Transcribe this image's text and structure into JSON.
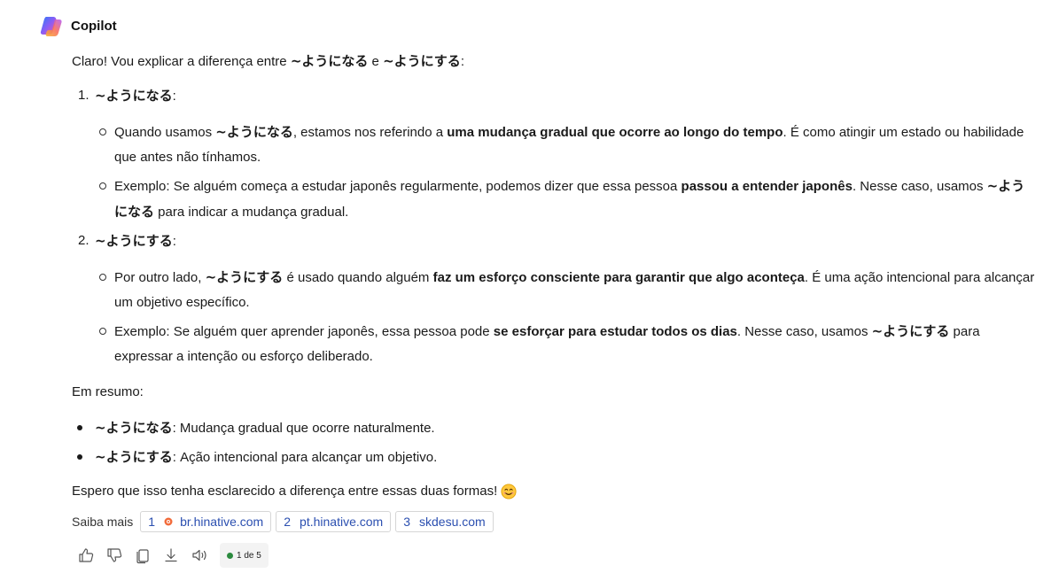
{
  "header": {
    "assistant_name": "Copilot"
  },
  "message": {
    "intro": {
      "prefix": "Claro! Vou explicar a diferença entre ",
      "term1": "~ようになる",
      "mid": " e ",
      "term2": "~ようにする",
      "suffix": ":"
    },
    "items": [
      {
        "number": "1.",
        "term": "~ようになる",
        "colon": ":",
        "points": [
          {
            "a": "Quando usamos ",
            "b": "~ようになる",
            "c": ", estamos nos referindo a ",
            "d": "uma mudança gradual que ocorre ao longo do tempo",
            "e": ". É como atingir um estado ou habilidade que antes não tínhamos."
          },
          {
            "a": "Exemplo: Se alguém começa a estudar japonês regularmente, podemos dizer que essa pessoa ",
            "b": "passou a entender japonês",
            "c": ". Nesse caso, usamos ",
            "d": "~ようになる",
            "e": " para indicar a mudança gradual."
          }
        ]
      },
      {
        "number": "2.",
        "term": "~ようにする",
        "colon": ":",
        "points": [
          {
            "a": "Por outro lado, ",
            "b": "~ようにする",
            "c": " é usado quando alguém ",
            "d": "faz um esforço consciente para garantir que algo aconteça",
            "e": ". É uma ação intencional para alcançar um objetivo específico."
          },
          {
            "a": "Exemplo: Se alguém quer aprender japonês, essa pessoa pode ",
            "b": "se esforçar para estudar todos os dias",
            "c": ". Nesse caso, usamos ",
            "d": "~ようにする",
            "e": " para expressar a intenção ou esforço deliberado."
          }
        ]
      }
    ],
    "summary_title": "Em resumo:",
    "summary": [
      {
        "term": "~ようになる",
        "text": ": Mudança gradual que ocorre naturalmente."
      },
      {
        "term": "~ようにする",
        "text": ": Ação intencional para alcançar um objetivo."
      }
    ],
    "closing": "Espero que isso tenha esclarecido a diferença entre essas duas formas!"
  },
  "sources": {
    "label": "Saiba mais",
    "items": [
      {
        "num": "1",
        "domain": "br.hinative.com",
        "has_favicon": true
      },
      {
        "num": "2",
        "domain": "pt.hinative.com",
        "has_favicon": false
      },
      {
        "num": "3",
        "domain": "skdesu.com",
        "has_favicon": false
      }
    ]
  },
  "actions": {
    "icons": [
      "thumbs-up-icon",
      "thumbs-down-icon",
      "copy-icon",
      "download-icon",
      "read-aloud-icon"
    ],
    "counter": "1 de 5",
    "status_color": "#2b8a3e"
  },
  "colors": {
    "link": "#2b4fb0",
    "text": "#1a1a1a"
  }
}
